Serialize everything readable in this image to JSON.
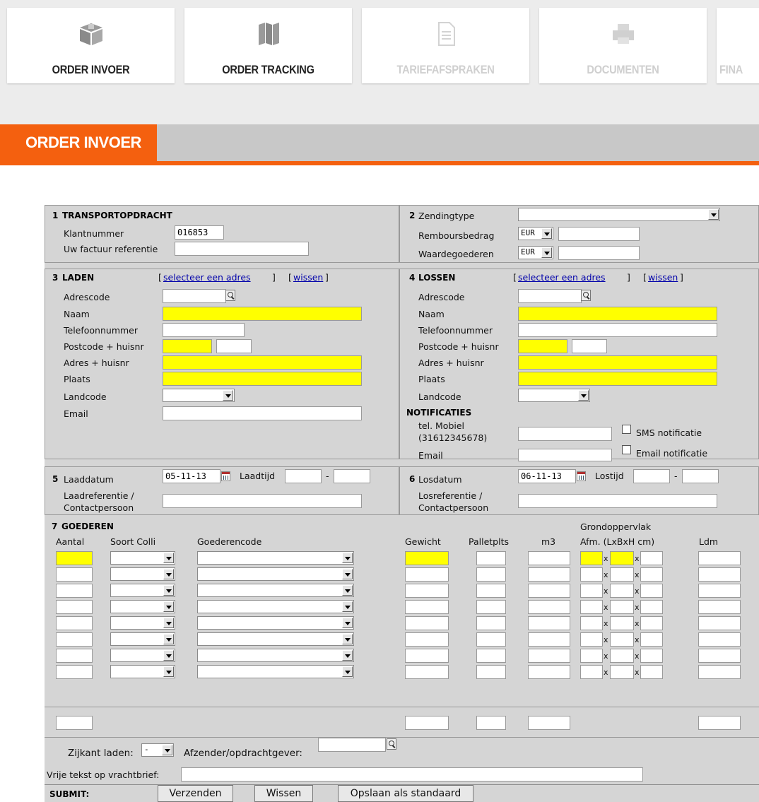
{
  "tabs": [
    {
      "label": "ORDER INVOER",
      "icon": "box-icon",
      "disabled": false
    },
    {
      "label": "ORDER TRACKING",
      "icon": "map-icon",
      "disabled": false
    },
    {
      "label": "TARIEFAFSPRAKEN",
      "icon": "document-icon",
      "disabled": true
    },
    {
      "label": "DOCUMENTEN",
      "icon": "printer-icon",
      "disabled": true
    },
    {
      "label": "FINA",
      "icon": "",
      "disabled": true
    }
  ],
  "page_title": "ORDER INVOER",
  "s1": {
    "header": "TRANSPORTOPDRACHT",
    "num": "1",
    "klant_label": "Klantnummer",
    "klant_value": "016853",
    "factuur_label": "Uw factuur referentie",
    "factuur_value": ""
  },
  "s2": {
    "num": "2",
    "zending_label": "Zendingtype",
    "rembours_label": "Rembours­bedrag",
    "rembours_currency": "EUR",
    "waarde_label": "Waardegoederen",
    "waarde_currency": "EUR"
  },
  "s3": {
    "num": "3",
    "header": "LADEN",
    "select_link": "selecteer een adres",
    "clear_link": "wissen",
    "adrescode": "Adrescode",
    "naam": "Naam",
    "telefoon": "Telefoonnummer",
    "postcode": "Postcode + huisnr",
    "adres": "Adres + huisnr",
    "plaats": "Plaats",
    "landcode": "Landcode",
    "email": "Email"
  },
  "s4": {
    "num": "4",
    "header": "LOSSEN",
    "select_link": "selecteer een adres",
    "clear_link": "wissen",
    "adrescode": "Adrescode",
    "naam": "Naam",
    "telefoon": "Telefoonnummer",
    "postcode": "Postcode + huisnr",
    "adres": "Adres + huisnr",
    "plaats": "Plaats",
    "landcode": "Landcode",
    "notif_header": "NOTIFICATIES",
    "mobiel_1": "tel. Mobiel",
    "mobiel_2": "(31612345678)",
    "sms_label": "SMS notificatie",
    "email": "Email",
    "email_notif_label": "Email notificatie"
  },
  "s5": {
    "num": "5",
    "datum_label": "Laaddatum",
    "datum_value": "05-11-13",
    "tijd_label": "Laadtijd",
    "dash": "-",
    "ref_1": "Laadreferentie /",
    "ref_2": "Contactpersoon"
  },
  "s6": {
    "num": "6",
    "datum_label": "Losdatum",
    "datum_value": "06-11-13",
    "tijd_label": "Lostijd",
    "dash": "-",
    "ref_1": "Losreferentie /",
    "ref_2": "Contactpersoon"
  },
  "s7": {
    "num": "7",
    "header": "GOEDEREN",
    "grond": "Grondoppervlak",
    "cols": {
      "aantal": "Aantal",
      "soort": "Soort Colli",
      "code": "Goederencode",
      "gewicht": "Gewicht",
      "pallet": "Palletplts",
      "m3": "m3",
      "afm": "Afm. (LxBxH cm)",
      "ldm": "Ldm"
    },
    "x": "x"
  },
  "bottom": {
    "zijkant_label": "Zijkant laden:",
    "zijkant_value": "-",
    "afzender_label": "Afzender/opdrachtgever:",
    "vrije_label": "Vrije tekst op vrachtbrief:"
  },
  "footer": {
    "submit_label": "SUBMIT:",
    "verzenden": "Verzenden",
    "wissen": "Wissen",
    "opslaan": "Opslaan als standaard"
  }
}
